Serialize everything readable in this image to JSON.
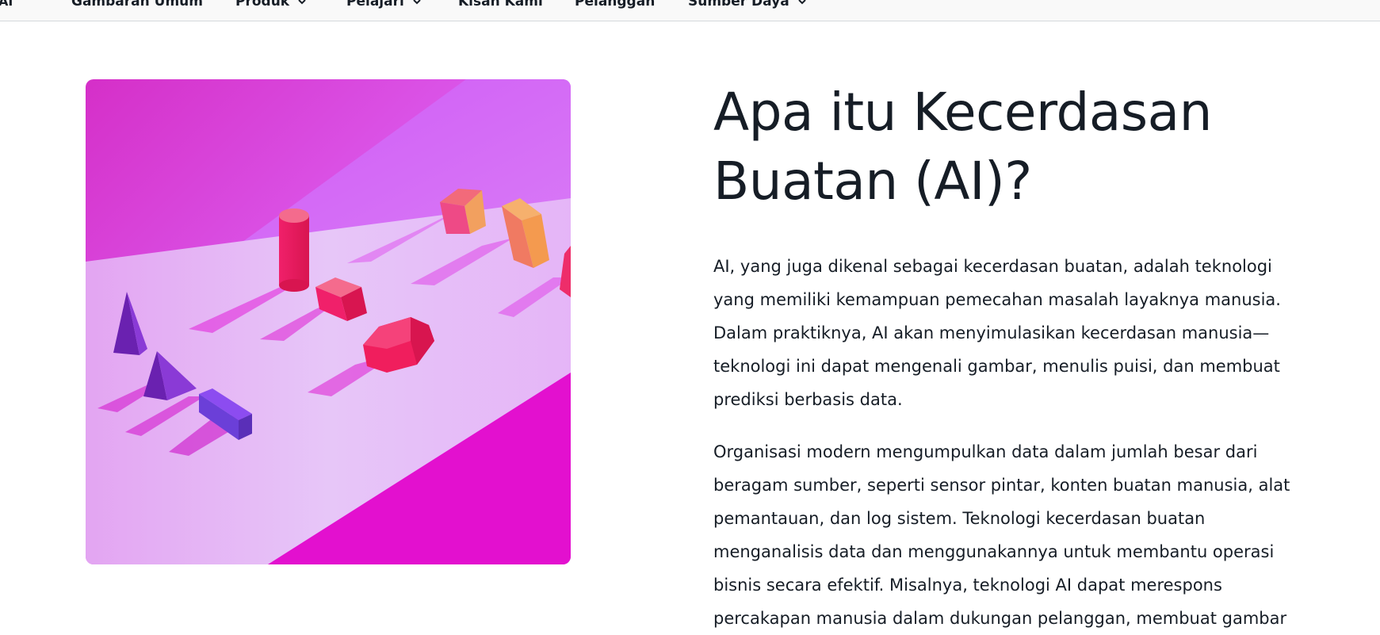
{
  "nav": {
    "brand": "AI",
    "items": [
      {
        "label": "Gambaran Umum",
        "dropdown": false
      },
      {
        "label": "Produk",
        "dropdown": true
      },
      {
        "label": "Pelajari",
        "dropdown": true
      },
      {
        "label": "Kisah Kami",
        "dropdown": false
      },
      {
        "label": "Pelanggan",
        "dropdown": false
      },
      {
        "label": "Sumber Daya",
        "dropdown": true
      }
    ]
  },
  "hero": {
    "image_icon": "abstract-geometric-shapes-image",
    "title": "Apa itu Kecerdasan Buatan (AI)?",
    "paragraphs": [
      "AI, yang juga dikenal sebagai kecerdasan buatan, adalah teknologi yang memiliki kemampuan pemecahan masalah layaknya manusia. Dalam praktiknya, AI akan menyimulasikan kecerdasan manusia—teknologi ini dapat mengenali gambar, menulis puisi, dan membuat prediksi berbasis data.",
      "Organisasi modern mengumpulkan data dalam jumlah besar dari beragam sumber, seperti sensor pintar, konten buatan manusia, alat pemantauan, dan log sistem. Teknologi kecerdasan buatan menganalisis data dan menggunakannya untuk membantu operasi bisnis secara efektif. Misalnya, teknologi AI dapat merespons percakapan manusia dalam dukungan pelanggan, membuat gambar"
    ]
  },
  "colors": {
    "text": "#161d26",
    "nav_bg": "#f9f9f9",
    "magenta": "#e020d0",
    "light_band": "#e6c4f7"
  }
}
